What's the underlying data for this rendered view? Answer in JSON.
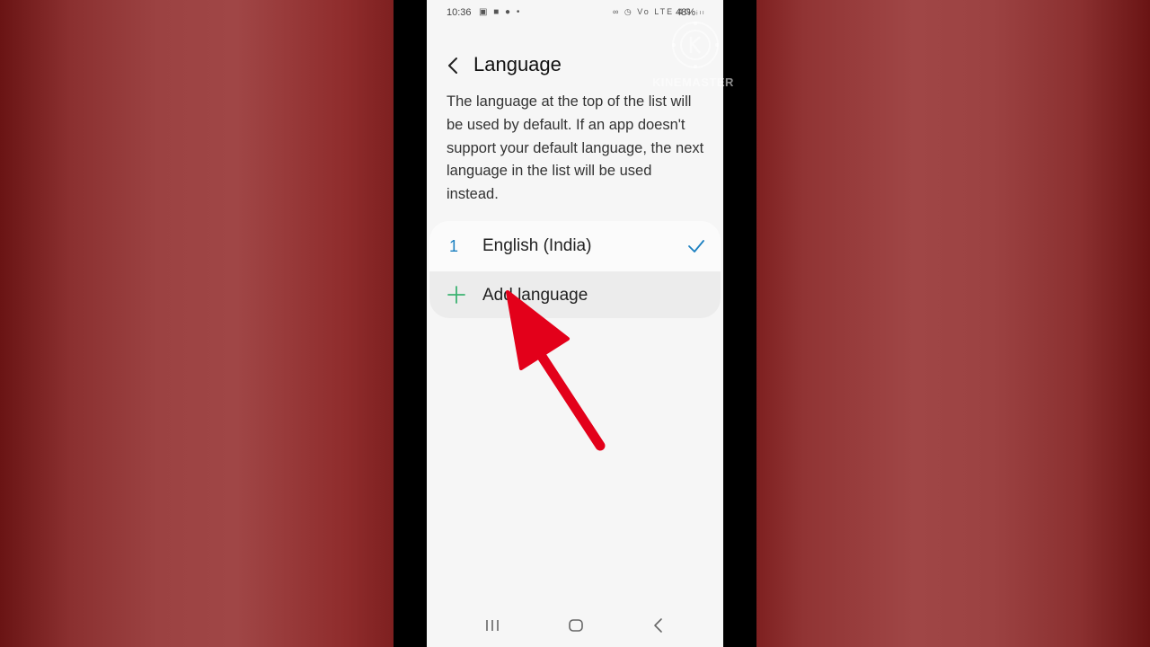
{
  "status_bar": {
    "time": "10:36",
    "left_icons": "▣ ■ ● •",
    "right_icons": "∞ ◷ Vo LTE 4G ᵢₗₗ",
    "battery": "48%"
  },
  "header": {
    "title": "Language"
  },
  "description": "The language at the top of the list will be used by default. If an app doesn't support your default language, the next language in the list will be used instead.",
  "languages": [
    {
      "number": "1",
      "name": "English (India)",
      "selected": true
    }
  ],
  "add_language": {
    "label": "Add language"
  },
  "watermark": {
    "text": "KINEMASTER"
  },
  "colors": {
    "accent_blue": "#1a7fc0",
    "plus_green": "#3cb371",
    "arrow_red": "#e3001a",
    "background_red": "#9c4242"
  },
  "icons": [
    "back-arrow-icon",
    "check-icon",
    "plus-icon",
    "recents-icon",
    "home-icon",
    "nav-back-icon",
    "kinemaster-logo-icon"
  ]
}
